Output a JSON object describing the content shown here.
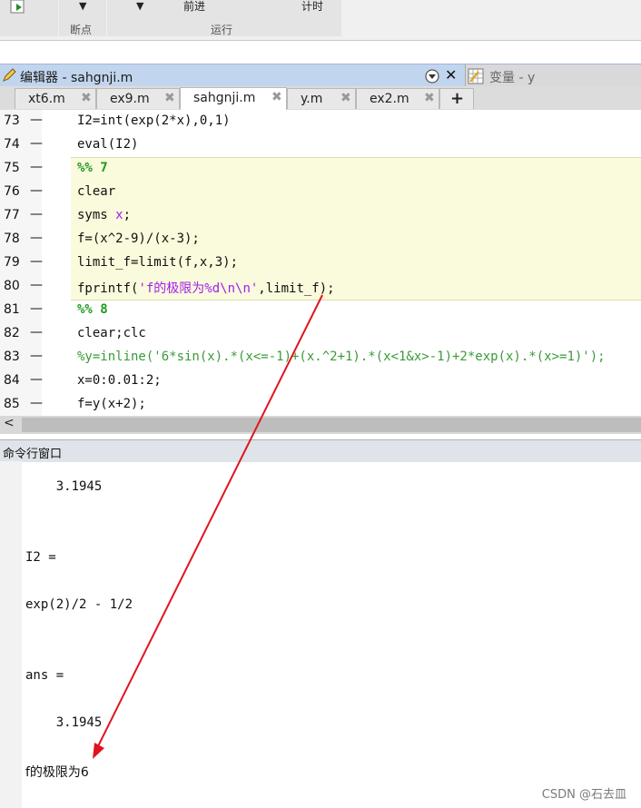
{
  "toolstrip": {
    "group1_label": "断点",
    "group2_label": "运行",
    "forward_label": "前进",
    "timer_label": "计时"
  },
  "editor": {
    "title": "编辑器 - sahgnji.m",
    "variable_panel_title": "变量 - y",
    "tabs": [
      {
        "label": "xt6.m"
      },
      {
        "label": "ex9.m"
      },
      {
        "label": "sahgnji.m"
      },
      {
        "label": "y.m"
      },
      {
        "label": "ex2.m"
      }
    ],
    "add_tab": "+",
    "close_glyph": "✖",
    "dash": "—",
    "lines": [
      {
        "num": "73",
        "segments": [
          {
            "t": "I2=int(exp(2*x),0,1)",
            "c": ""
          }
        ]
      },
      {
        "num": "74",
        "segments": [
          {
            "t": "eval(I2)",
            "c": ""
          }
        ]
      },
      {
        "num": "75",
        "segments": [
          {
            "t": "%% 7",
            "c": "kw"
          }
        ]
      },
      {
        "num": "76",
        "segments": [
          {
            "t": "clear",
            "c": ""
          }
        ]
      },
      {
        "num": "77",
        "segments": [
          {
            "t": "syms ",
            "c": ""
          },
          {
            "t": "x",
            "c": "var"
          },
          {
            "t": ";",
            "c": ""
          }
        ]
      },
      {
        "num": "78",
        "segments": [
          {
            "t": "f=(x^2-9)/(x-3);",
            "c": ""
          }
        ]
      },
      {
        "num": "79",
        "segments": [
          {
            "t": "limit_f=limit(f,x,3);",
            "c": ""
          }
        ]
      },
      {
        "num": "80",
        "segments": [
          {
            "t": "fprintf(",
            "c": ""
          },
          {
            "t": "'f的极限为%d\\n\\n'",
            "c": "str"
          },
          {
            "t": ",limit_f);",
            "c": ""
          }
        ]
      },
      {
        "num": "81",
        "segments": [
          {
            "t": "%% 8",
            "c": "kw"
          }
        ]
      },
      {
        "num": "82",
        "segments": [
          {
            "t": "clear;clc",
            "c": ""
          }
        ]
      },
      {
        "num": "83",
        "segments": [
          {
            "t": "%y=inline('6*sin(x).*(x<=-1)+(x.^2+1).*(x<1&x>-1)+2*exp(x).*(x>=1)');",
            "c": "cm"
          }
        ]
      },
      {
        "num": "84",
        "segments": [
          {
            "t": "x=0:0.01:2;",
            "c": ""
          }
        ]
      },
      {
        "num": "85",
        "segments": [
          {
            "t": "f=y(x+2);",
            "c": ""
          }
        ]
      }
    ]
  },
  "scrollbar": {
    "left_arrow": "<"
  },
  "command_window": {
    "title": "命令行窗口",
    "output": [
      {
        "text": "    3.1945",
        "row": "a"
      },
      {
        "text": "I2 =",
        "row": "b"
      },
      {
        "text": "exp(2)/2 - 1/2",
        "row": "c"
      },
      {
        "text": "ans =",
        "row": "d"
      },
      {
        "text": "    3.1945",
        "row": "e"
      },
      {
        "text": "f的极限为6",
        "row": "f"
      }
    ]
  },
  "watermark": "CSDN @石去皿",
  "colors": {
    "annotation_arrow": "#e0141e",
    "cell_highlight": "#fafadc",
    "comment_green": "#3a9a3a",
    "string_purple": "#a020f0"
  }
}
